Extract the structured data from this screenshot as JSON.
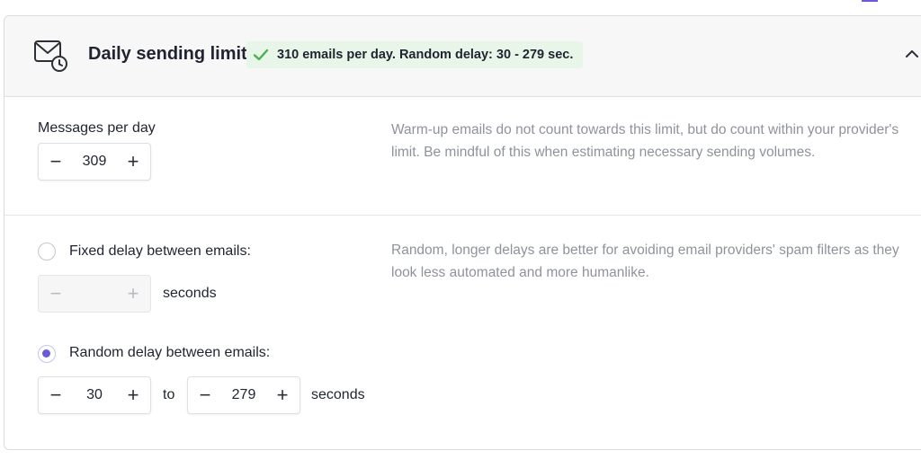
{
  "header": {
    "title": "Daily sending limit",
    "status": "310 emails per day. Random delay: 30 - 279 sec.",
    "status_color": "#4caf50",
    "icon": "envelope-clock-icon",
    "collapse_icon": "chevron-up-icon"
  },
  "messages": {
    "label": "Messages per day",
    "value": "309",
    "minus": "−",
    "plus": "+",
    "hint": "Warm-up emails do not count towards this limit, but do count within your provider's limit. Be mindful of this when estimating necessary sending volumes."
  },
  "delay": {
    "hint": "Random, longer delays are better for avoiding email providers' spam filters as they look less automated and more humanlike.",
    "fixed": {
      "label": "Fixed delay between emails:",
      "selected": false,
      "value": "",
      "minus": "−",
      "plus": "+",
      "unit": "seconds"
    },
    "random": {
      "label": "Random delay between emails:",
      "selected": true,
      "min": "30",
      "max": "279",
      "minus": "−",
      "plus": "+",
      "to": "to",
      "unit": "seconds"
    }
  },
  "accent_color": "#6b5bd8"
}
